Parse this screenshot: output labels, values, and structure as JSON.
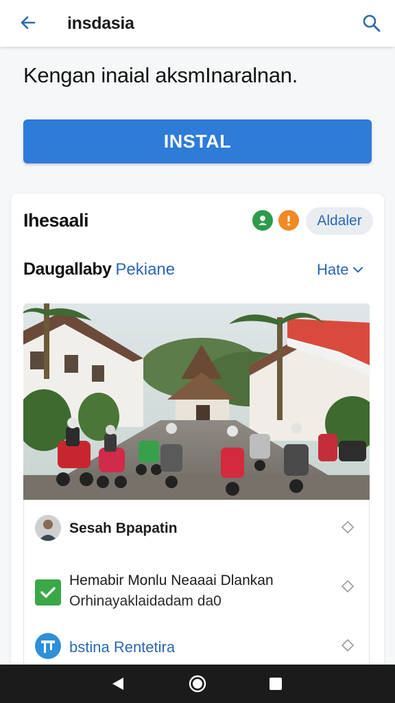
{
  "appbar": {
    "title": "insdasia",
    "back_icon": "arrow-left-icon",
    "search_icon": "search-icon",
    "accent": "#2a67b3"
  },
  "headline": "Kengan inaial aksmInaralnan.",
  "install_button": {
    "label": "INSTAL",
    "color": "#2e7bd8"
  },
  "card": {
    "title": "Ihesaali",
    "badges": [
      {
        "icon": "leaf-icon",
        "color": "#2e9b4a"
      },
      {
        "icon": "info-icon",
        "color": "#ef8a24"
      }
    ],
    "update_chip": "Aldaler",
    "subheading_bold": "Daugallaby",
    "subheading_link": "Pekiane",
    "sort_label": "Hate",
    "photo": "street-scene-with-motorcycles-image",
    "items": [
      {
        "icon": "avatar-icon",
        "title": "Sesah Bpapatin",
        "chevron": "chevron-icon"
      },
      {
        "icon": "check-icon",
        "title": "Hemabir Monlu Neaaai Dlankan",
        "subtitle": "Orhinayaklaidadam da0",
        "chevron": "chevron-icon"
      },
      {
        "icon": "app-icon",
        "title": "bstina Rentetira",
        "chevron": "chevron-icon"
      }
    ]
  },
  "navbar": {
    "back": "nav-back-icon",
    "home": "nav-home-icon",
    "recent": "nav-recent-icon"
  }
}
